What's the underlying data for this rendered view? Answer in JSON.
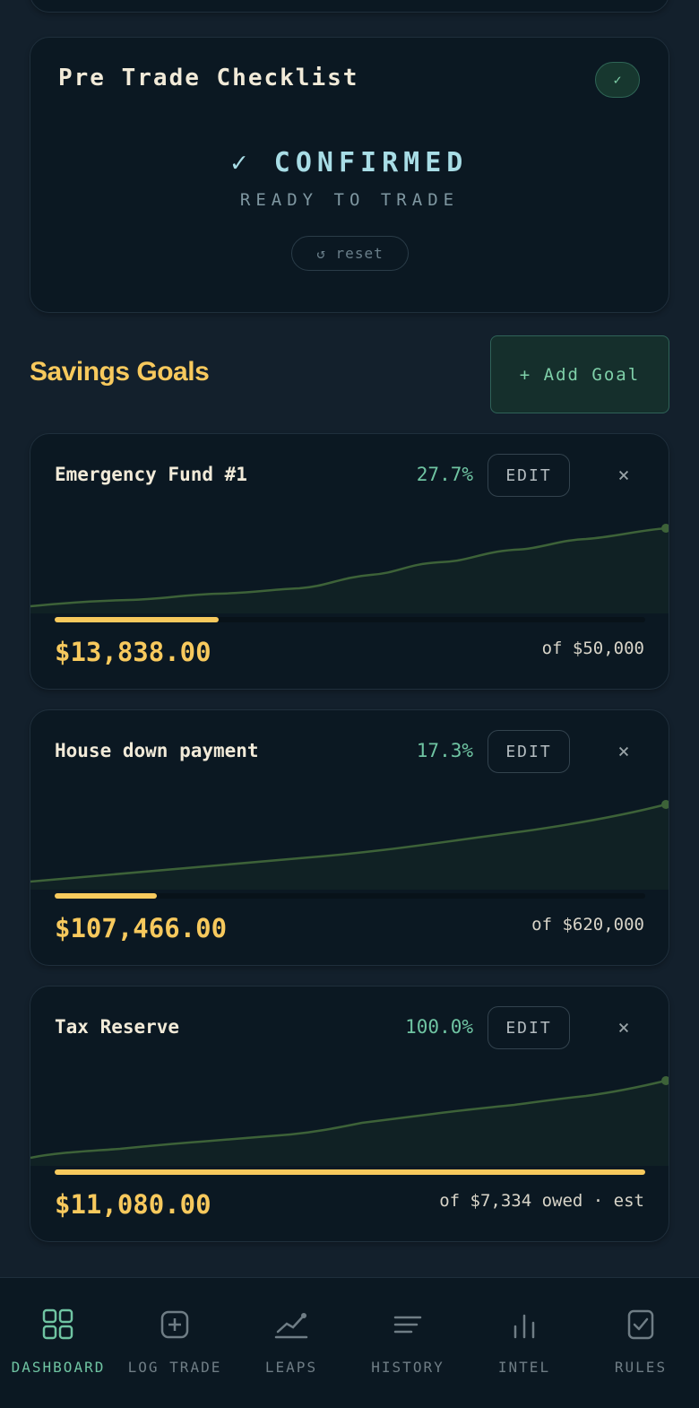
{
  "checklist": {
    "title": "Pre Trade Checklist",
    "badge": "✓",
    "status": "✓ CONFIRMED",
    "substatus": "READY TO TRADE",
    "reset_label": "↺ reset"
  },
  "savings": {
    "title": "Savings Goals",
    "add_label": "+ Add Goal",
    "edit_label": "EDIT",
    "close_glyph": "×",
    "goals": [
      {
        "name": "Emergency Fund #1",
        "percent": "27.7%",
        "progress": 0.277,
        "amount": "$13,838.00",
        "target": "of $50,000"
      },
      {
        "name": "House down payment",
        "percent": "17.3%",
        "progress": 0.173,
        "amount": "$107,466.00",
        "target": "of $620,000"
      },
      {
        "name": "Tax Reserve",
        "percent": "100.0%",
        "progress": 1.0,
        "amount": "$11,080.00",
        "target": "of $7,334 owed · est"
      }
    ]
  },
  "nav": {
    "items": [
      {
        "label": "DASHBOARD",
        "icon": "grid-icon",
        "active": true
      },
      {
        "label": "LOG TRADE",
        "icon": "plus-square-icon",
        "active": false
      },
      {
        "label": "LEAPS",
        "icon": "trend-line-icon",
        "active": false
      },
      {
        "label": "HISTORY",
        "icon": "lines-icon",
        "active": false
      },
      {
        "label": "INTEL",
        "icon": "bar-chart-icon",
        "active": false
      },
      {
        "label": "RULES",
        "icon": "clipboard-check-icon",
        "active": false
      }
    ]
  },
  "colors": {
    "background": "#13202c",
    "card": "#0b1822",
    "accent_gold": "#f7c95d",
    "accent_green": "#6fc4a2",
    "sparkline": "#3d6238"
  }
}
